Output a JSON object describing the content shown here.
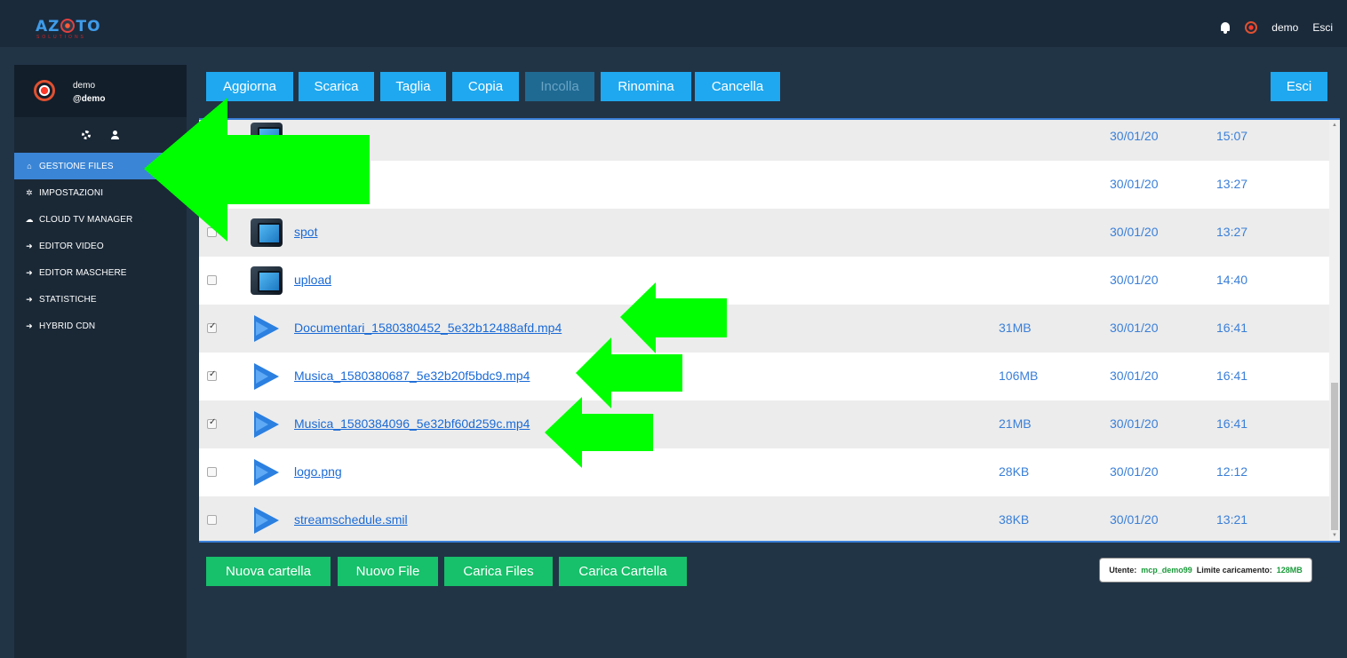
{
  "header": {
    "logo_text": "AZ",
    "logo_text2": "TO",
    "logo_subtitle": "SOLUTIONS",
    "user_name": "demo",
    "logout_label": "Esci"
  },
  "sidebar": {
    "user_name": "demo",
    "user_handle": "@demo",
    "items": [
      {
        "label": "GESTIONE FILES",
        "icon": "home-icon",
        "active": true
      },
      {
        "label": "IMPOSTAZIONI",
        "icon": "gear-icon",
        "active": false
      },
      {
        "label": "CLOUD TV MANAGER",
        "icon": "cloud-icon",
        "active": false
      },
      {
        "label": "EDITOR VIDEO",
        "icon": "arrow-right-icon",
        "active": false
      },
      {
        "label": "EDITOR MASCHERE",
        "icon": "arrow-right-icon",
        "active": false
      },
      {
        "label": "STATISTICHE",
        "icon": "arrow-right-icon",
        "active": false
      },
      {
        "label": "HYBRID CDN",
        "icon": "arrow-right-icon",
        "active": false
      }
    ]
  },
  "toolbar": {
    "refresh": "Aggiorna",
    "download": "Scarica",
    "cut": "Taglia",
    "copy": "Copia",
    "paste": "Incolla",
    "rename": "Rinomina",
    "delete": "Cancella",
    "exit": "Esci"
  },
  "files": [
    {
      "name": "",
      "type": "folder",
      "size": "",
      "date": "30/01/20",
      "time": "15:07",
      "checked": false
    },
    {
      "name": "",
      "type": "folder",
      "size": "",
      "date": "30/01/20",
      "time": "13:27",
      "checked": false
    },
    {
      "name": "spot",
      "type": "folder",
      "size": "",
      "date": "30/01/20",
      "time": "13:27",
      "checked": false
    },
    {
      "name": "upload",
      "type": "folder",
      "size": "",
      "date": "30/01/20",
      "time": "14:40",
      "checked": false
    },
    {
      "name": "Documentari_1580380452_5e32b12488afd.mp4",
      "type": "file",
      "size": "31MB",
      "date": "30/01/20",
      "time": "16:41",
      "checked": true
    },
    {
      "name": "Musica_1580380687_5e32b20f5bdc9.mp4",
      "type": "file",
      "size": "106MB",
      "date": "30/01/20",
      "time": "16:41",
      "checked": true
    },
    {
      "name": "Musica_1580384096_5e32bf60d259c.mp4",
      "type": "file",
      "size": "21MB",
      "date": "30/01/20",
      "time": "16:41",
      "checked": true
    },
    {
      "name": "logo.png",
      "type": "file",
      "size": "28KB",
      "date": "30/01/20",
      "time": "12:12",
      "checked": false
    },
    {
      "name": "streamschedule.smil",
      "type": "file",
      "size": "38KB",
      "date": "30/01/20",
      "time": "13:21",
      "checked": false
    }
  ],
  "actions": {
    "new_folder": "Nuova cartella",
    "new_file": "Nuovo File",
    "upload_files": "Carica Files",
    "upload_folder": "Carica Cartella"
  },
  "info": {
    "user_label": "Utente:",
    "user_value": "mcp_demo99",
    "limit_label": "Limite caricamento:",
    "limit_value": "128MB"
  },
  "colors": {
    "accent_blue": "#1fa8ef",
    "action_green": "#17c06a",
    "annotation_arrow": "#00ff00"
  }
}
